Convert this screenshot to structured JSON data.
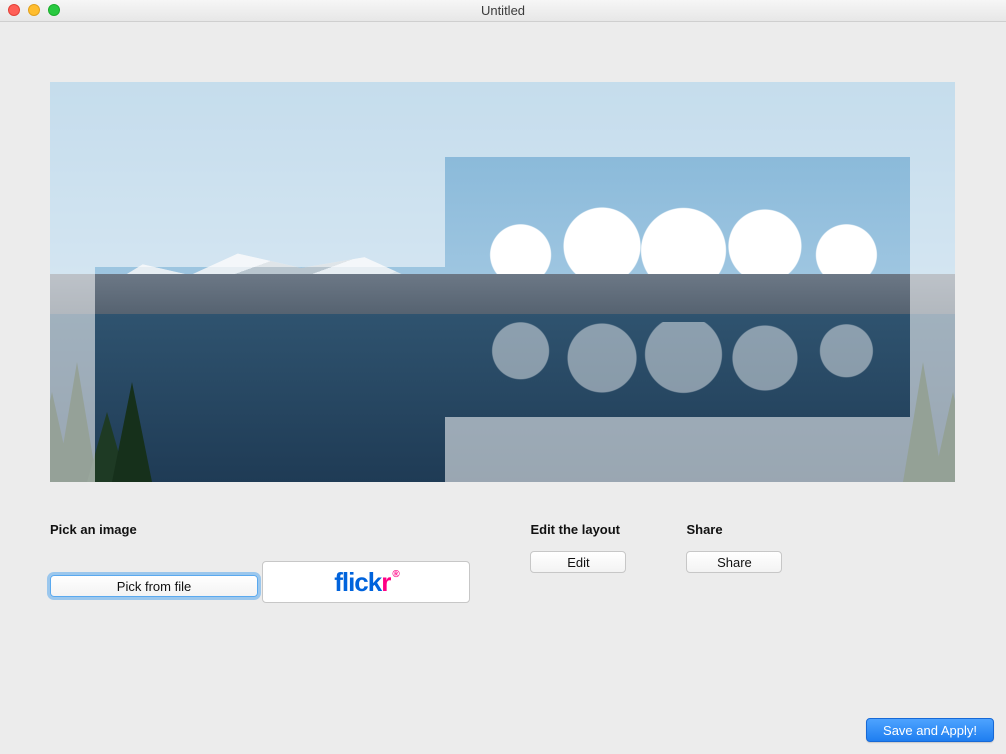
{
  "window": {
    "title": "Untitled"
  },
  "sections": {
    "pick": {
      "heading": "Pick an image",
      "pick_from_file_label": "Pick from file",
      "flickr_label": "flickr"
    },
    "edit": {
      "heading": "Edit the layout",
      "edit_label": "Edit"
    },
    "share": {
      "heading": "Share",
      "share_label": "Share"
    }
  },
  "primary_action_label": "Save and Apply!",
  "brand": {
    "flickr": {
      "blue_part": "flick",
      "pink_part": "r",
      "reg_mark": "®"
    }
  }
}
